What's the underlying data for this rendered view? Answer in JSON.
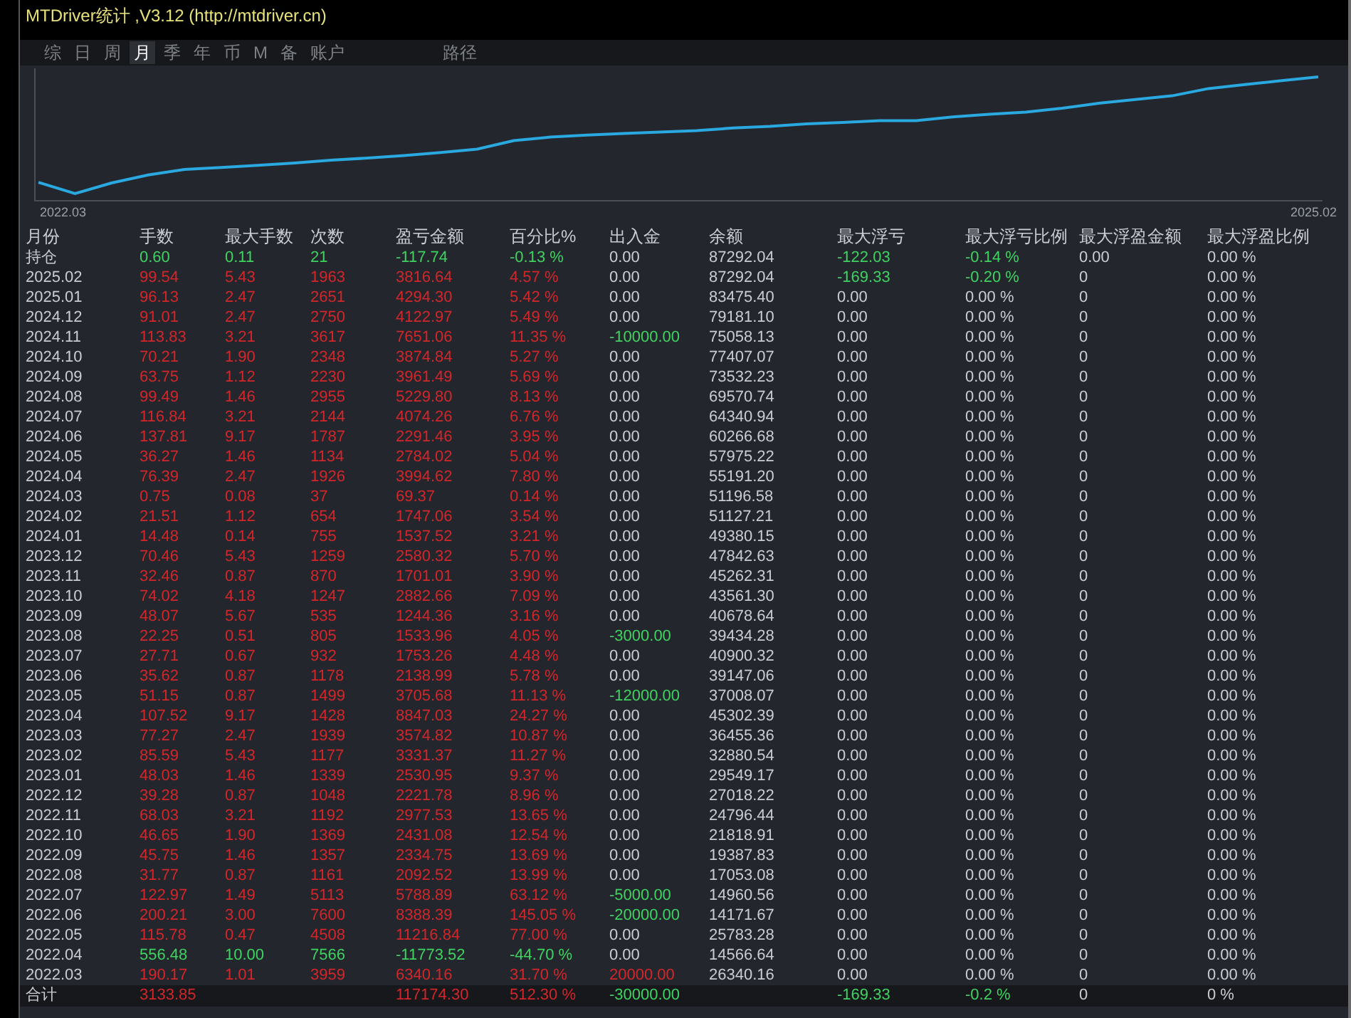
{
  "window": {
    "title": "MTDriver统计 ,V3.12 (http://mtdriver.cn)"
  },
  "tabs": [
    {
      "label": "综",
      "selected": false
    },
    {
      "label": "日",
      "selected": false
    },
    {
      "label": "周",
      "selected": false
    },
    {
      "label": "月",
      "selected": true
    },
    {
      "label": "季",
      "selected": false
    },
    {
      "label": "年",
      "selected": false
    },
    {
      "label": "币",
      "selected": false
    },
    {
      "label": "M",
      "selected": false
    },
    {
      "label": "备",
      "selected": false
    },
    {
      "label": "账户",
      "selected": false
    },
    {
      "label": "路径",
      "selected": false
    }
  ],
  "equity_chart": {
    "start_label": "2022.03",
    "end_label": "2025.02"
  },
  "table": {
    "columns": [
      "月份",
      "手数",
      "最大手数",
      "次数",
      "盈亏金额",
      "百分比%",
      "出入金",
      "余额",
      "最大浮亏",
      "最大浮亏比例",
      "最大浮盈金额",
      "最大浮盈比例"
    ],
    "rows": [
      {
        "month": "持仓",
        "stats": {
          "cells": [
            "0.60",
            "0.11",
            "21",
            "-117.74",
            "-0.13 %"
          ],
          "color": "#3fd260"
        },
        "flow": {
          "text": "0.00",
          "color": "#c9cdd2"
        },
        "balance": "87292.04",
        "float_loss": {
          "cells": [
            "-122.03",
            "-0.14 %"
          ],
          "color": "#3fd260"
        },
        "float_profit": [
          "0.00",
          "0.00 %"
        ]
      },
      {
        "month": "2025.02",
        "stats": {
          "cells": [
            "99.54",
            "5.43",
            "1963",
            "3816.64",
            "4.57 %"
          ],
          "color": "#d3262a"
        },
        "flow": {
          "text": "0.00",
          "color": "#c9cdd2"
        },
        "balance": "87292.04",
        "float_loss": {
          "cells": [
            "-169.33",
            "-0.20 %"
          ],
          "color": "#3fd260"
        },
        "float_profit": [
          "0",
          "0.00 %"
        ]
      },
      {
        "month": "2025.01",
        "stats": {
          "cells": [
            "96.13",
            "2.47",
            "2651",
            "4294.30",
            "5.42 %"
          ],
          "color": "#d3262a"
        },
        "flow": {
          "text": "0.00",
          "color": "#c9cdd2"
        },
        "balance": "83475.40",
        "float_loss": {
          "cells": [
            "0.00",
            "0.00 %"
          ],
          "color": "#c9cdd2"
        },
        "float_profit": [
          "0",
          "0.00 %"
        ]
      },
      {
        "month": "2024.12",
        "stats": {
          "cells": [
            "91.01",
            "2.47",
            "2750",
            "4122.97",
            "5.49 %"
          ],
          "color": "#d3262a"
        },
        "flow": {
          "text": "0.00",
          "color": "#c9cdd2"
        },
        "balance": "79181.10",
        "float_loss": {
          "cells": [
            "0.00",
            "0.00 %"
          ],
          "color": "#c9cdd2"
        },
        "float_profit": [
          "0",
          "0.00 %"
        ]
      },
      {
        "month": "2024.11",
        "stats": {
          "cells": [
            "113.83",
            "3.21",
            "3617",
            "7651.06",
            "11.35 %"
          ],
          "color": "#d3262a"
        },
        "flow": {
          "text": "-10000.00",
          "color": "#3fd260"
        },
        "balance": "75058.13",
        "float_loss": {
          "cells": [
            "0.00",
            "0.00 %"
          ],
          "color": "#c9cdd2"
        },
        "float_profit": [
          "0",
          "0.00 %"
        ]
      },
      {
        "month": "2024.10",
        "stats": {
          "cells": [
            "70.21",
            "1.90",
            "2348",
            "3874.84",
            "5.27 %"
          ],
          "color": "#d3262a"
        },
        "flow": {
          "text": "0.00",
          "color": "#c9cdd2"
        },
        "balance": "77407.07",
        "float_loss": {
          "cells": [
            "0.00",
            "0.00 %"
          ],
          "color": "#c9cdd2"
        },
        "float_profit": [
          "0",
          "0.00 %"
        ]
      },
      {
        "month": "2024.09",
        "stats": {
          "cells": [
            "63.75",
            "1.12",
            "2230",
            "3961.49",
            "5.69 %"
          ],
          "color": "#d3262a"
        },
        "flow": {
          "text": "0.00",
          "color": "#c9cdd2"
        },
        "balance": "73532.23",
        "float_loss": {
          "cells": [
            "0.00",
            "0.00 %"
          ],
          "color": "#c9cdd2"
        },
        "float_profit": [
          "0",
          "0.00 %"
        ]
      },
      {
        "month": "2024.08",
        "stats": {
          "cells": [
            "99.49",
            "1.46",
            "2955",
            "5229.80",
            "8.13 %"
          ],
          "color": "#d3262a"
        },
        "flow": {
          "text": "0.00",
          "color": "#c9cdd2"
        },
        "balance": "69570.74",
        "float_loss": {
          "cells": [
            "0.00",
            "0.00 %"
          ],
          "color": "#c9cdd2"
        },
        "float_profit": [
          "0",
          "0.00 %"
        ]
      },
      {
        "month": "2024.07",
        "stats": {
          "cells": [
            "116.84",
            "3.21",
            "2144",
            "4074.26",
            "6.76 %"
          ],
          "color": "#d3262a"
        },
        "flow": {
          "text": "0.00",
          "color": "#c9cdd2"
        },
        "balance": "64340.94",
        "float_loss": {
          "cells": [
            "0.00",
            "0.00 %"
          ],
          "color": "#c9cdd2"
        },
        "float_profit": [
          "0",
          "0.00 %"
        ]
      },
      {
        "month": "2024.06",
        "stats": {
          "cells": [
            "137.81",
            "9.17",
            "1787",
            "2291.46",
            "3.95 %"
          ],
          "color": "#d3262a"
        },
        "flow": {
          "text": "0.00",
          "color": "#c9cdd2"
        },
        "balance": "60266.68",
        "float_loss": {
          "cells": [
            "0.00",
            "0.00 %"
          ],
          "color": "#c9cdd2"
        },
        "float_profit": [
          "0",
          "0.00 %"
        ]
      },
      {
        "month": "2024.05",
        "stats": {
          "cells": [
            "36.27",
            "1.46",
            "1134",
            "2784.02",
            "5.04 %"
          ],
          "color": "#d3262a"
        },
        "flow": {
          "text": "0.00",
          "color": "#c9cdd2"
        },
        "balance": "57975.22",
        "float_loss": {
          "cells": [
            "0.00",
            "0.00 %"
          ],
          "color": "#c9cdd2"
        },
        "float_profit": [
          "0",
          "0.00 %"
        ]
      },
      {
        "month": "2024.04",
        "stats": {
          "cells": [
            "76.39",
            "2.47",
            "1926",
            "3994.62",
            "7.80 %"
          ],
          "color": "#d3262a"
        },
        "flow": {
          "text": "0.00",
          "color": "#c9cdd2"
        },
        "balance": "55191.20",
        "float_loss": {
          "cells": [
            "0.00",
            "0.00 %"
          ],
          "color": "#c9cdd2"
        },
        "float_profit": [
          "0",
          "0.00 %"
        ]
      },
      {
        "month": "2024.03",
        "stats": {
          "cells": [
            "0.75",
            "0.08",
            "37",
            "69.37",
            "0.14 %"
          ],
          "color": "#d3262a"
        },
        "flow": {
          "text": "0.00",
          "color": "#c9cdd2"
        },
        "balance": "51196.58",
        "float_loss": {
          "cells": [
            "0.00",
            "0.00 %"
          ],
          "color": "#c9cdd2"
        },
        "float_profit": [
          "0",
          "0.00 %"
        ]
      },
      {
        "month": "2024.02",
        "stats": {
          "cells": [
            "21.51",
            "1.12",
            "654",
            "1747.06",
            "3.54 %"
          ],
          "color": "#d3262a"
        },
        "flow": {
          "text": "0.00",
          "color": "#c9cdd2"
        },
        "balance": "51127.21",
        "float_loss": {
          "cells": [
            "0.00",
            "0.00 %"
          ],
          "color": "#c9cdd2"
        },
        "float_profit": [
          "0",
          "0.00 %"
        ]
      },
      {
        "month": "2024.01",
        "stats": {
          "cells": [
            "14.48",
            "0.14",
            "755",
            "1537.52",
            "3.21 %"
          ],
          "color": "#d3262a"
        },
        "flow": {
          "text": "0.00",
          "color": "#c9cdd2"
        },
        "balance": "49380.15",
        "float_loss": {
          "cells": [
            "0.00",
            "0.00 %"
          ],
          "color": "#c9cdd2"
        },
        "float_profit": [
          "0",
          "0.00 %"
        ]
      },
      {
        "month": "2023.12",
        "stats": {
          "cells": [
            "70.46",
            "5.43",
            "1259",
            "2580.32",
            "5.70 %"
          ],
          "color": "#d3262a"
        },
        "flow": {
          "text": "0.00",
          "color": "#c9cdd2"
        },
        "balance": "47842.63",
        "float_loss": {
          "cells": [
            "0.00",
            "0.00 %"
          ],
          "color": "#c9cdd2"
        },
        "float_profit": [
          "0",
          "0.00 %"
        ]
      },
      {
        "month": "2023.11",
        "stats": {
          "cells": [
            "32.46",
            "0.87",
            "870",
            "1701.01",
            "3.90 %"
          ],
          "color": "#d3262a"
        },
        "flow": {
          "text": "0.00",
          "color": "#c9cdd2"
        },
        "balance": "45262.31",
        "float_loss": {
          "cells": [
            "0.00",
            "0.00 %"
          ],
          "color": "#c9cdd2"
        },
        "float_profit": [
          "0",
          "0.00 %"
        ]
      },
      {
        "month": "2023.10",
        "stats": {
          "cells": [
            "74.02",
            "4.18",
            "1247",
            "2882.66",
            "7.09 %"
          ],
          "color": "#d3262a"
        },
        "flow": {
          "text": "0.00",
          "color": "#c9cdd2"
        },
        "balance": "43561.30",
        "float_loss": {
          "cells": [
            "0.00",
            "0.00 %"
          ],
          "color": "#c9cdd2"
        },
        "float_profit": [
          "0",
          "0.00 %"
        ]
      },
      {
        "month": "2023.09",
        "stats": {
          "cells": [
            "48.07",
            "5.67",
            "535",
            "1244.36",
            "3.16 %"
          ],
          "color": "#d3262a"
        },
        "flow": {
          "text": "0.00",
          "color": "#c9cdd2"
        },
        "balance": "40678.64",
        "float_loss": {
          "cells": [
            "0.00",
            "0.00 %"
          ],
          "color": "#c9cdd2"
        },
        "float_profit": [
          "0",
          "0.00 %"
        ]
      },
      {
        "month": "2023.08",
        "stats": {
          "cells": [
            "22.25",
            "0.51",
            "805",
            "1533.96",
            "4.05 %"
          ],
          "color": "#d3262a"
        },
        "flow": {
          "text": "-3000.00",
          "color": "#3fd260"
        },
        "balance": "39434.28",
        "float_loss": {
          "cells": [
            "0.00",
            "0.00 %"
          ],
          "color": "#c9cdd2"
        },
        "float_profit": [
          "0",
          "0.00 %"
        ]
      },
      {
        "month": "2023.07",
        "stats": {
          "cells": [
            "27.71",
            "0.67",
            "932",
            "1753.26",
            "4.48 %"
          ],
          "color": "#d3262a"
        },
        "flow": {
          "text": "0.00",
          "color": "#c9cdd2"
        },
        "balance": "40900.32",
        "float_loss": {
          "cells": [
            "0.00",
            "0.00 %"
          ],
          "color": "#c9cdd2"
        },
        "float_profit": [
          "0",
          "0.00 %"
        ]
      },
      {
        "month": "2023.06",
        "stats": {
          "cells": [
            "35.62",
            "0.87",
            "1178",
            "2138.99",
            "5.78 %"
          ],
          "color": "#d3262a"
        },
        "flow": {
          "text": "0.00",
          "color": "#c9cdd2"
        },
        "balance": "39147.06",
        "float_loss": {
          "cells": [
            "0.00",
            "0.00 %"
          ],
          "color": "#c9cdd2"
        },
        "float_profit": [
          "0",
          "0.00 %"
        ]
      },
      {
        "month": "2023.05",
        "stats": {
          "cells": [
            "51.15",
            "0.87",
            "1499",
            "3705.68",
            "11.13 %"
          ],
          "color": "#d3262a"
        },
        "flow": {
          "text": "-12000.00",
          "color": "#3fd260"
        },
        "balance": "37008.07",
        "float_loss": {
          "cells": [
            "0.00",
            "0.00 %"
          ],
          "color": "#c9cdd2"
        },
        "float_profit": [
          "0",
          "0.00 %"
        ]
      },
      {
        "month": "2023.04",
        "stats": {
          "cells": [
            "107.52",
            "9.17",
            "1428",
            "8847.03",
            "24.27 %"
          ],
          "color": "#d3262a"
        },
        "flow": {
          "text": "0.00",
          "color": "#c9cdd2"
        },
        "balance": "45302.39",
        "float_loss": {
          "cells": [
            "0.00",
            "0.00 %"
          ],
          "color": "#c9cdd2"
        },
        "float_profit": [
          "0",
          "0.00 %"
        ]
      },
      {
        "month": "2023.03",
        "stats": {
          "cells": [
            "77.27",
            "2.47",
            "1939",
            "3574.82",
            "10.87 %"
          ],
          "color": "#d3262a"
        },
        "flow": {
          "text": "0.00",
          "color": "#c9cdd2"
        },
        "balance": "36455.36",
        "float_loss": {
          "cells": [
            "0.00",
            "0.00 %"
          ],
          "color": "#c9cdd2"
        },
        "float_profit": [
          "0",
          "0.00 %"
        ]
      },
      {
        "month": "2023.02",
        "stats": {
          "cells": [
            "85.59",
            "5.43",
            "1177",
            "3331.37",
            "11.27 %"
          ],
          "color": "#d3262a"
        },
        "flow": {
          "text": "0.00",
          "color": "#c9cdd2"
        },
        "balance": "32880.54",
        "float_loss": {
          "cells": [
            "0.00",
            "0.00 %"
          ],
          "color": "#c9cdd2"
        },
        "float_profit": [
          "0",
          "0.00 %"
        ]
      },
      {
        "month": "2023.01",
        "stats": {
          "cells": [
            "48.03",
            "1.46",
            "1339",
            "2530.95",
            "9.37 %"
          ],
          "color": "#d3262a"
        },
        "flow": {
          "text": "0.00",
          "color": "#c9cdd2"
        },
        "balance": "29549.17",
        "float_loss": {
          "cells": [
            "0.00",
            "0.00 %"
          ],
          "color": "#c9cdd2"
        },
        "float_profit": [
          "0",
          "0.00 %"
        ]
      },
      {
        "month": "2022.12",
        "stats": {
          "cells": [
            "39.28",
            "0.87",
            "1048",
            "2221.78",
            "8.96 %"
          ],
          "color": "#d3262a"
        },
        "flow": {
          "text": "0.00",
          "color": "#c9cdd2"
        },
        "balance": "27018.22",
        "float_loss": {
          "cells": [
            "0.00",
            "0.00 %"
          ],
          "color": "#c9cdd2"
        },
        "float_profit": [
          "0",
          "0.00 %"
        ]
      },
      {
        "month": "2022.11",
        "stats": {
          "cells": [
            "68.03",
            "3.21",
            "1192",
            "2977.53",
            "13.65 %"
          ],
          "color": "#d3262a"
        },
        "flow": {
          "text": "0.00",
          "color": "#c9cdd2"
        },
        "balance": "24796.44",
        "float_loss": {
          "cells": [
            "0.00",
            "0.00 %"
          ],
          "color": "#c9cdd2"
        },
        "float_profit": [
          "0",
          "0.00 %"
        ]
      },
      {
        "month": "2022.10",
        "stats": {
          "cells": [
            "46.65",
            "1.90",
            "1369",
            "2431.08",
            "12.54 %"
          ],
          "color": "#d3262a"
        },
        "flow": {
          "text": "0.00",
          "color": "#c9cdd2"
        },
        "balance": "21818.91",
        "float_loss": {
          "cells": [
            "0.00",
            "0.00 %"
          ],
          "color": "#c9cdd2"
        },
        "float_profit": [
          "0",
          "0.00 %"
        ]
      },
      {
        "month": "2022.09",
        "stats": {
          "cells": [
            "45.75",
            "1.46",
            "1357",
            "2334.75",
            "13.69 %"
          ],
          "color": "#d3262a"
        },
        "flow": {
          "text": "0.00",
          "color": "#c9cdd2"
        },
        "balance": "19387.83",
        "float_loss": {
          "cells": [
            "0.00",
            "0.00 %"
          ],
          "color": "#c9cdd2"
        },
        "float_profit": [
          "0",
          "0.00 %"
        ]
      },
      {
        "month": "2022.08",
        "stats": {
          "cells": [
            "31.77",
            "0.87",
            "1161",
            "2092.52",
            "13.99 %"
          ],
          "color": "#d3262a"
        },
        "flow": {
          "text": "0.00",
          "color": "#c9cdd2"
        },
        "balance": "17053.08",
        "float_loss": {
          "cells": [
            "0.00",
            "0.00 %"
          ],
          "color": "#c9cdd2"
        },
        "float_profit": [
          "0",
          "0.00 %"
        ]
      },
      {
        "month": "2022.07",
        "stats": {
          "cells": [
            "122.97",
            "1.49",
            "5113",
            "5788.89",
            "63.12 %"
          ],
          "color": "#d3262a"
        },
        "flow": {
          "text": "-5000.00",
          "color": "#3fd260"
        },
        "balance": "14960.56",
        "float_loss": {
          "cells": [
            "0.00",
            "0.00 %"
          ],
          "color": "#c9cdd2"
        },
        "float_profit": [
          "0",
          "0.00 %"
        ]
      },
      {
        "month": "2022.06",
        "stats": {
          "cells": [
            "200.21",
            "3.00",
            "7600",
            "8388.39",
            "145.05 %"
          ],
          "color": "#d3262a"
        },
        "flow": {
          "text": "-20000.00",
          "color": "#3fd260"
        },
        "balance": "14171.67",
        "float_loss": {
          "cells": [
            "0.00",
            "0.00 %"
          ],
          "color": "#c9cdd2"
        },
        "float_profit": [
          "0",
          "0.00 %"
        ]
      },
      {
        "month": "2022.05",
        "stats": {
          "cells": [
            "115.78",
            "0.47",
            "4508",
            "11216.84",
            "77.00 %"
          ],
          "color": "#d3262a"
        },
        "flow": {
          "text": "0.00",
          "color": "#c9cdd2"
        },
        "balance": "25783.28",
        "float_loss": {
          "cells": [
            "0.00",
            "0.00 %"
          ],
          "color": "#c9cdd2"
        },
        "float_profit": [
          "0",
          "0.00 %"
        ]
      },
      {
        "month": "2022.04",
        "stats": {
          "cells": [
            "556.48",
            "10.00",
            "7566",
            "-11773.52",
            "-44.70 %"
          ],
          "color": "#3fd260"
        },
        "flow": {
          "text": "0.00",
          "color": "#c9cdd2"
        },
        "balance": "14566.64",
        "float_loss": {
          "cells": [
            "0.00",
            "0.00 %"
          ],
          "color": "#c9cdd2"
        },
        "float_profit": [
          "0",
          "0.00 %"
        ]
      },
      {
        "month": "2022.03",
        "stats": {
          "cells": [
            "190.17",
            "1.01",
            "3959",
            "6340.16",
            "31.70 %"
          ],
          "color": "#d3262a"
        },
        "flow": {
          "text": "20000.00",
          "color": "#d3262a"
        },
        "balance": "26340.16",
        "float_loss": {
          "cells": [
            "0.00",
            "0.00 %"
          ],
          "color": "#c9cdd2"
        },
        "float_profit": [
          "0",
          "0.00 %"
        ]
      }
    ],
    "total": {
      "month": "合计",
      "stats": {
        "cells": [
          "3133.85",
          null,
          null,
          "117174.30",
          "512.30 %"
        ],
        "color": "#d3262a"
      },
      "flow": {
        "text": "-30000.00",
        "color": "#3fd260"
      },
      "float_loss": {
        "cells": [
          "-169.33",
          "-0.2 %"
        ],
        "color": "#3fd260"
      },
      "float_profit": [
        "0",
        "0 %"
      ]
    }
  }
}
